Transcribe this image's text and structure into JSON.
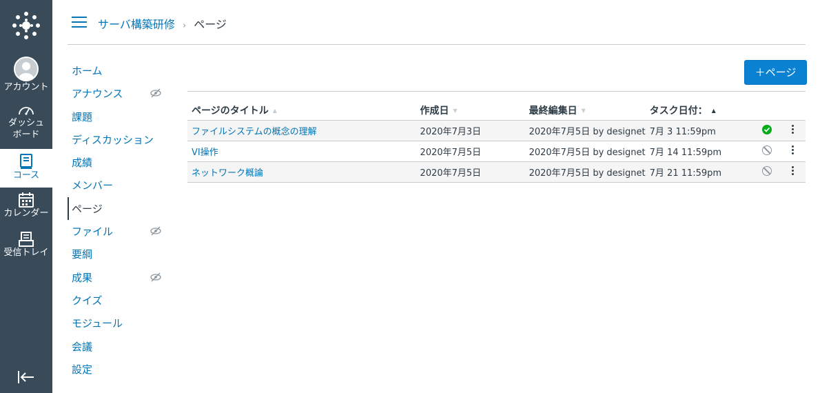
{
  "global_nav": {
    "items": [
      {
        "id": "account",
        "label": "アカウント"
      },
      {
        "id": "dashboard",
        "label": "ダッシュボード"
      },
      {
        "id": "courses",
        "label": "コース"
      },
      {
        "id": "calendar",
        "label": "カレンダー"
      },
      {
        "id": "inbox",
        "label": "受信トレイ"
      }
    ]
  },
  "breadcrumb": {
    "course": "サーバ構築研修",
    "separator": "›",
    "current": "ページ"
  },
  "course_nav": {
    "items": [
      {
        "label": "ホーム",
        "hidden": false
      },
      {
        "label": "アナウンス",
        "hidden": true
      },
      {
        "label": "課題",
        "hidden": false
      },
      {
        "label": "ディスカッション",
        "hidden": false
      },
      {
        "label": "成績",
        "hidden": false
      },
      {
        "label": "メンバー",
        "hidden": false
      },
      {
        "label": "ページ",
        "hidden": false,
        "active": true
      },
      {
        "label": "ファイル",
        "hidden": true
      },
      {
        "label": "要綱",
        "hidden": false
      },
      {
        "label": "成果",
        "hidden": true
      },
      {
        "label": "クイズ",
        "hidden": false
      },
      {
        "label": "モジュール",
        "hidden": false
      },
      {
        "label": "会議",
        "hidden": false
      },
      {
        "label": "設定",
        "hidden": false
      }
    ]
  },
  "add_page_button": "＋ページ",
  "table": {
    "headers": [
      {
        "label": "ページのタイトル",
        "sort": "▲",
        "active": false
      },
      {
        "label": "作成日",
        "sort": "▼",
        "active": false
      },
      {
        "label": "最終編集日",
        "sort": "▼",
        "active": false
      },
      {
        "label": "タスク日付：",
        "sort": "▲",
        "active": true
      }
    ],
    "rows": [
      {
        "title": "ファイルシステムの概念の理解",
        "created": "2020年7月3日",
        "edited": "2020年7月5日 by designet",
        "todo": "7月 3 11:59pm",
        "published": true
      },
      {
        "title": "VI操作",
        "created": "2020年7月5日",
        "edited": "2020年7月5日 by designet",
        "todo": "7月 14 11:59pm",
        "published": false
      },
      {
        "title": "ネットワーク概論",
        "created": "2020年7月5日",
        "edited": "2020年7月5日 by designet",
        "todo": "7月 21 11:59pm",
        "published": false
      }
    ]
  },
  "colors": {
    "nav_bg": "#394b58",
    "link": "#0374b5",
    "button": "#0b81d2",
    "published": "#00ac18"
  }
}
